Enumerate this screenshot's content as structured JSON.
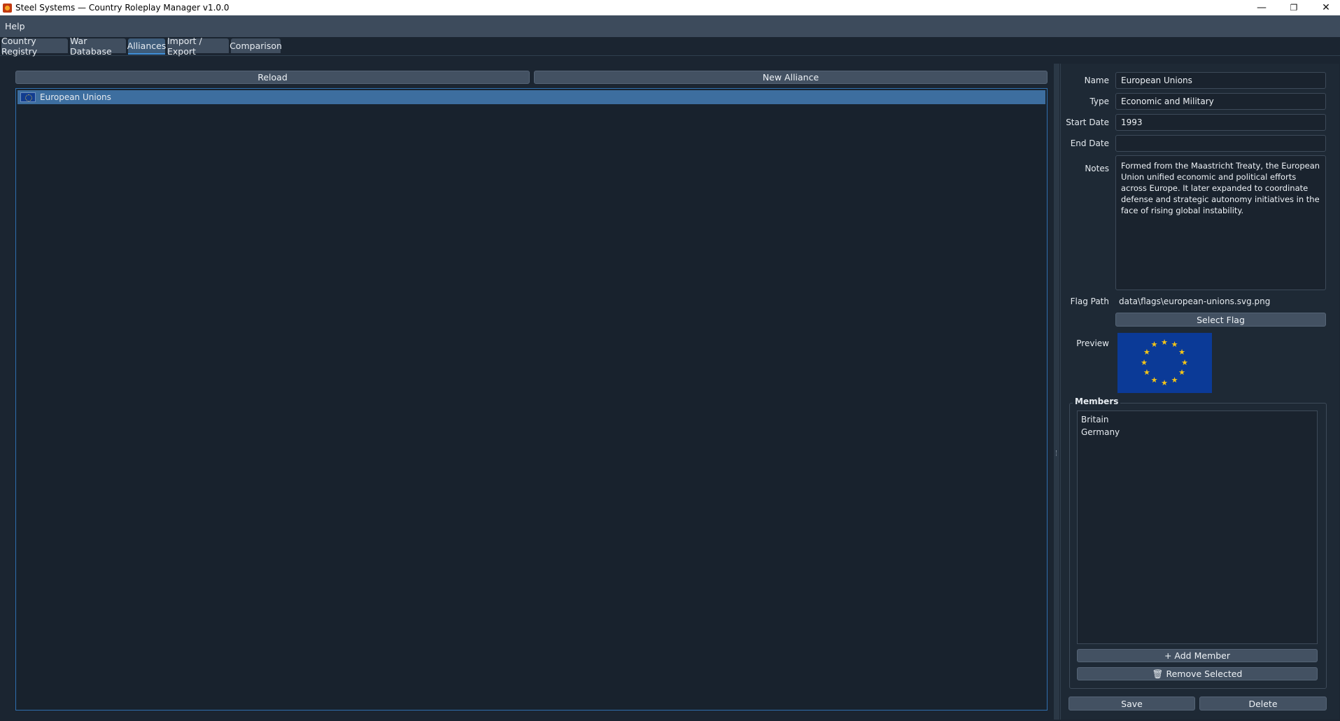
{
  "window": {
    "title": "Steel Systems — Country Roleplay Manager v1.0.0",
    "controls": {
      "minimize": "—",
      "maximize": "❐",
      "close": "✕"
    }
  },
  "menu": {
    "items": [
      "Help"
    ]
  },
  "tabs": [
    {
      "label": "Country Registry",
      "active": false
    },
    {
      "label": "War Database",
      "active": false
    },
    {
      "label": "Alliances",
      "active": true
    },
    {
      "label": "Import / Export",
      "active": false
    },
    {
      "label": "Comparison",
      "active": false
    }
  ],
  "toolbar": {
    "reload_label": "Reload",
    "new_alliance_label": "New Alliance"
  },
  "alliance_list": {
    "items": [
      {
        "name": "European Unions",
        "flag_icon": "eu-flag-icon",
        "selected": true
      }
    ]
  },
  "details": {
    "name_label": "Name",
    "name_value": "European Unions",
    "type_label": "Type",
    "type_value": "Economic and Military",
    "start_label": "Start Date",
    "start_value": "1993",
    "end_label": "End Date",
    "end_value": "",
    "notes_label": "Notes",
    "notes_value": "Formed from the Maastricht Treaty, the European Union unified economic and political efforts across Europe. It later expanded to coordinate defense and strategic autonomy initiatives in the face of rising global instability.",
    "flag_path_label": "Flag Path",
    "flag_path_value": "data\\flags\\european-unions.svg.png",
    "select_flag_label": "Select Flag",
    "preview_label": "Preview"
  },
  "members": {
    "title": "Members",
    "items": [
      "Britain",
      "Germany"
    ],
    "add_label": "+ Add Member",
    "remove_label": "🗑 Remove Selected"
  },
  "actions": {
    "save_label": "Save",
    "delete_label": "Delete"
  },
  "colors": {
    "accent": "#3f8fd8",
    "selection": "#3d6e9f",
    "background": "#1b2531",
    "flag_blue": "#0b3a97",
    "flag_star": "#f5c518"
  }
}
